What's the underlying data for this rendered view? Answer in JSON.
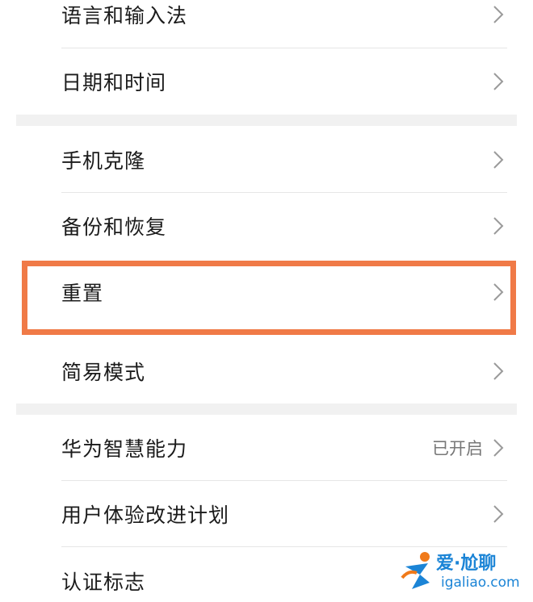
{
  "settings": {
    "group1": [
      {
        "label": "语言和输入法"
      },
      {
        "label": "日期和时间"
      }
    ],
    "group2": [
      {
        "label": "手机克隆"
      },
      {
        "label": "备份和恢复"
      },
      {
        "label": "重置"
      },
      {
        "label": "简易模式"
      }
    ],
    "group3": [
      {
        "label": "华为智慧能力",
        "status": "已开启"
      },
      {
        "label": "用户体验改进计划"
      },
      {
        "label": "认证标志"
      }
    ]
  },
  "highlight": {
    "color": "#f07a47",
    "target": "重置"
  },
  "watermark": {
    "title": "爱·尬聊",
    "url": "igaliao.com",
    "color": "#1b84d6"
  }
}
